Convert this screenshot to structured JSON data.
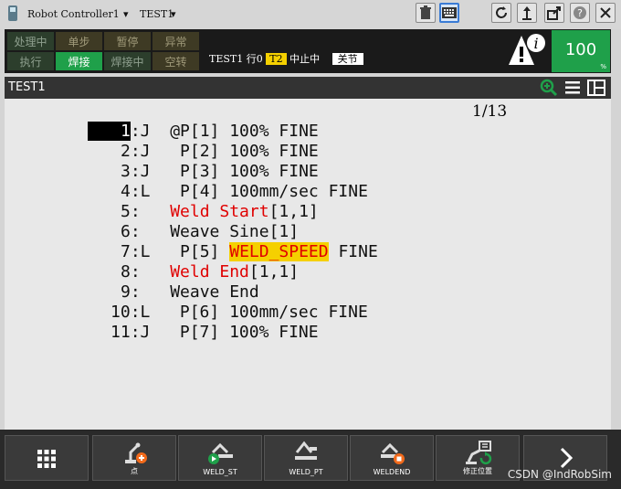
{
  "titlebar": {
    "controller": "Robot Controller1",
    "program": "TEST1",
    "icons": [
      "trash-icon",
      "keyboard-icon",
      "refresh-icon",
      "jog-icon",
      "export-icon",
      "help-icon",
      "close-icon"
    ]
  },
  "status": {
    "row1": [
      "处理中",
      "单步",
      "暂停",
      "异常"
    ],
    "row2": [
      "执行",
      "焊接",
      "焊接中",
      "空转"
    ],
    "program": "TEST1",
    "line": "行0",
    "mode": "T2",
    "state": "中止中",
    "step": "关节",
    "override": "100",
    "override_unit": "%"
  },
  "editor": {
    "title": "TEST1",
    "counter": "1/13",
    "lines": [
      {
        "n": "1",
        "sep": ":J  ",
        "a": "@P[1] 100% FINE"
      },
      {
        "n": "2",
        "sep": ":J  ",
        "a": " P[2] 100% FINE"
      },
      {
        "n": "3",
        "sep": ":J  ",
        "a": " P[3] 100% FINE"
      },
      {
        "n": "4",
        "sep": ":L  ",
        "a": " P[4] 100mm/sec FINE"
      },
      {
        "n": "5",
        "sep": ":   ",
        "red": "Weld Start",
        "b": "[1,1]"
      },
      {
        "n": "6",
        "sep": ":   ",
        "a": "Weave Sine[1]"
      },
      {
        "n": "7",
        "sep": ":L  ",
        "a": " P[5] ",
        "hl": "WELD_SPEED",
        "b": " FINE"
      },
      {
        "n": "8",
        "sep": ":   ",
        "red": "Weld End",
        "b": "[1,1]"
      },
      {
        "n": "9",
        "sep": ":   ",
        "a": "Weave End"
      },
      {
        "n": "10",
        "sep": ":L  ",
        "a": " P[6] 100mm/sec FINE"
      },
      {
        "n": "11",
        "sep": ":J  ",
        "a": " P[7] 100% FINE"
      }
    ]
  },
  "fkeys": [
    "",
    "点",
    "WELD_ST",
    "WELD_PT",
    "WELDEND",
    "修正位置",
    ""
  ],
  "watermark": "CSDN @IndRobSim",
  "colors": {
    "green": "#1fa04a",
    "yellow": "#f5d000",
    "red": "#e00000"
  }
}
